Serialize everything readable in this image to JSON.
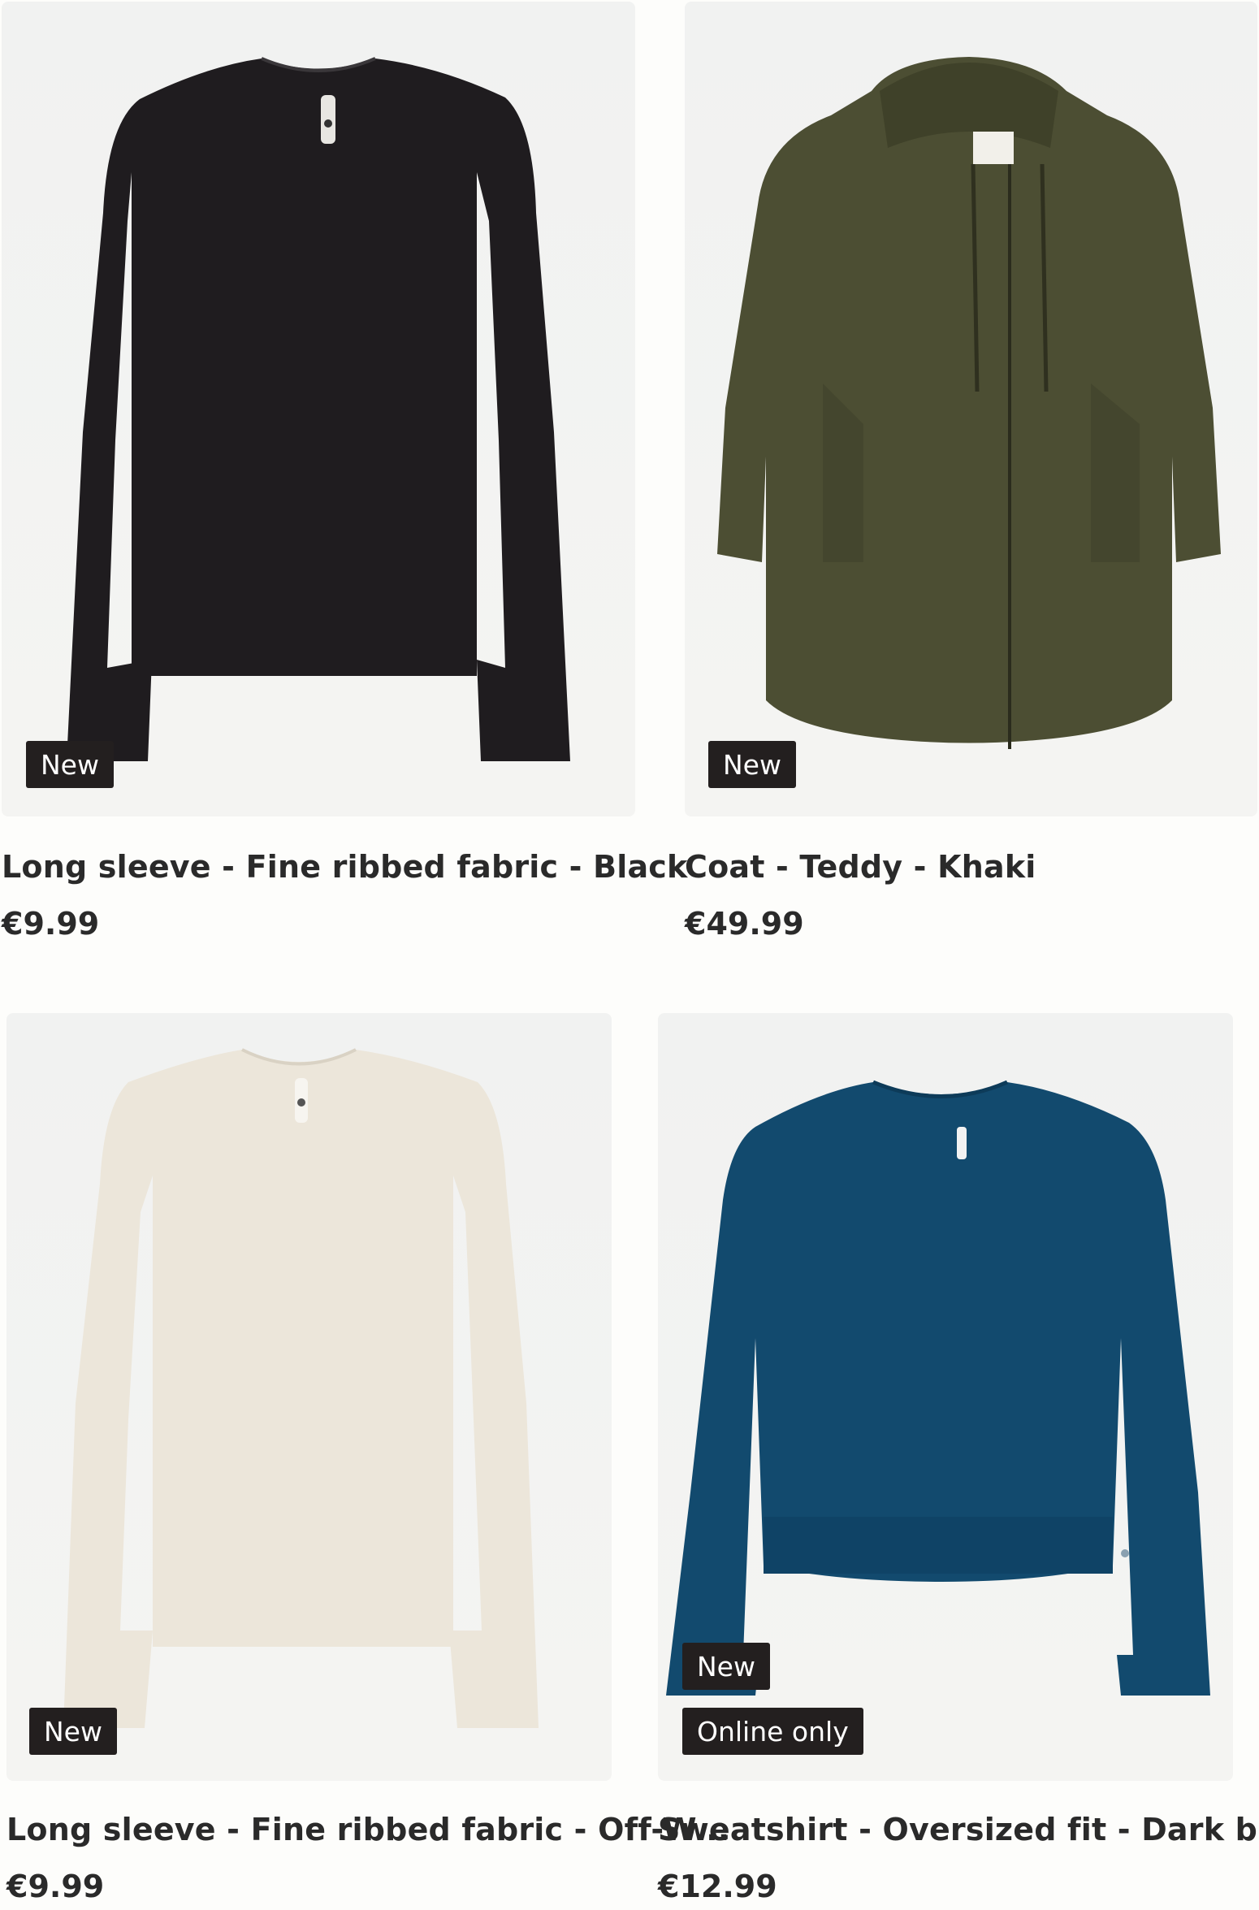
{
  "products": [
    {
      "title": "Long sleeve - Fine ribbed fabric - Black",
      "price": "€9.99",
      "badges": [
        "New"
      ],
      "garment_color": "#201d20",
      "image_icon": "black-long-sleeve-top-image"
    },
    {
      "title": "Coat - Teddy - Khaki",
      "price": "€49.99",
      "badges": [
        "New"
      ],
      "garment_color": "#4d4f34",
      "image_icon": "khaki-teddy-coat-image"
    },
    {
      "title": "Long sleeve - Fine ribbed fabric - Off-W...",
      "price": "€9.99",
      "badges": [
        "New"
      ],
      "garment_color": "#ece6da",
      "image_icon": "off-white-long-sleeve-top-image"
    },
    {
      "title": "Sweatshirt - Oversized fit - Dark blue",
      "price": "€12.99",
      "badges": [
        "New",
        "Online only"
      ],
      "garment_color": "#124a6e",
      "image_icon": "dark-blue-sweatshirt-image"
    }
  ]
}
